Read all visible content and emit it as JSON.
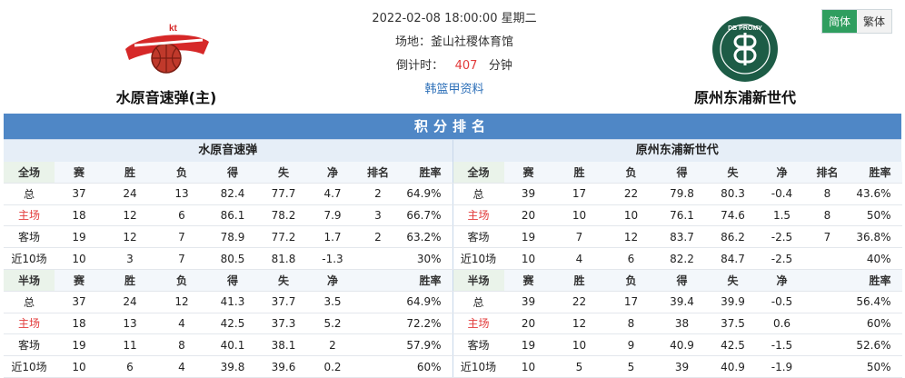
{
  "header": {
    "datetime": "2022-02-08 18:00:00 星期二",
    "venue": "场地：釜山社稷体育馆",
    "countdown_label": "倒计时：",
    "countdown_value": "407",
    "countdown_unit": "分钟",
    "league_link": "韩篮甲资料",
    "home_name": "水原音速弹(主)",
    "away_name": "原州东浦新世代",
    "home_logo_text": "kt",
    "away_logo_text": "DB PROMY"
  },
  "lang": {
    "simplified": "简体",
    "traditional": "繁体"
  },
  "title": "积分排名",
  "teams": {
    "home": "水原音速弹",
    "away": "原州东浦新世代"
  },
  "colors": {
    "accent": "#4f87c6",
    "active_tab": "#2f9e5f",
    "home_label": "#e23b3b"
  },
  "full_headers": [
    "全场",
    "赛",
    "胜",
    "负",
    "得",
    "失",
    "净",
    "排名",
    "胜率"
  ],
  "half_headers": [
    "半场",
    "赛",
    "胜",
    "负",
    "得",
    "失",
    "净",
    "",
    "胜率"
  ],
  "home_full": [
    [
      "总",
      "37",
      "24",
      "13",
      "82.4",
      "77.7",
      "4.7",
      "2",
      "64.9%"
    ],
    [
      "主场",
      "18",
      "12",
      "6",
      "86.1",
      "78.2",
      "7.9",
      "3",
      "66.7%"
    ],
    [
      "客场",
      "19",
      "12",
      "7",
      "78.9",
      "77.2",
      "1.7",
      "2",
      "63.2%"
    ],
    [
      "近10场",
      "10",
      "3",
      "7",
      "80.5",
      "81.8",
      "-1.3",
      "",
      "30%"
    ]
  ],
  "home_half": [
    [
      "总",
      "37",
      "24",
      "12",
      "41.3",
      "37.7",
      "3.5",
      "",
      "64.9%"
    ],
    [
      "主场",
      "18",
      "13",
      "4",
      "42.5",
      "37.3",
      "5.2",
      "",
      "72.2%"
    ],
    [
      "客场",
      "19",
      "11",
      "8",
      "40.1",
      "38.1",
      "2",
      "",
      "57.9%"
    ],
    [
      "近10场",
      "10",
      "6",
      "4",
      "39.8",
      "39.6",
      "0.2",
      "",
      "60%"
    ]
  ],
  "away_full": [
    [
      "总",
      "39",
      "17",
      "22",
      "79.8",
      "80.3",
      "-0.4",
      "8",
      "43.6%"
    ],
    [
      "主场",
      "20",
      "10",
      "10",
      "76.1",
      "74.6",
      "1.5",
      "8",
      "50%"
    ],
    [
      "客场",
      "19",
      "7",
      "12",
      "83.7",
      "86.2",
      "-2.5",
      "7",
      "36.8%"
    ],
    [
      "近10场",
      "10",
      "4",
      "6",
      "82.2",
      "84.7",
      "-2.5",
      "",
      "40%"
    ]
  ],
  "away_half": [
    [
      "总",
      "39",
      "22",
      "17",
      "39.4",
      "39.9",
      "-0.5",
      "",
      "56.4%"
    ],
    [
      "主场",
      "20",
      "12",
      "8",
      "38",
      "37.5",
      "0.6",
      "",
      "60%"
    ],
    [
      "客场",
      "19",
      "10",
      "9",
      "40.9",
      "42.5",
      "-1.5",
      "",
      "52.6%"
    ],
    [
      "近10场",
      "10",
      "5",
      "5",
      "39",
      "40.9",
      "-1.9",
      "",
      "50%"
    ]
  ]
}
